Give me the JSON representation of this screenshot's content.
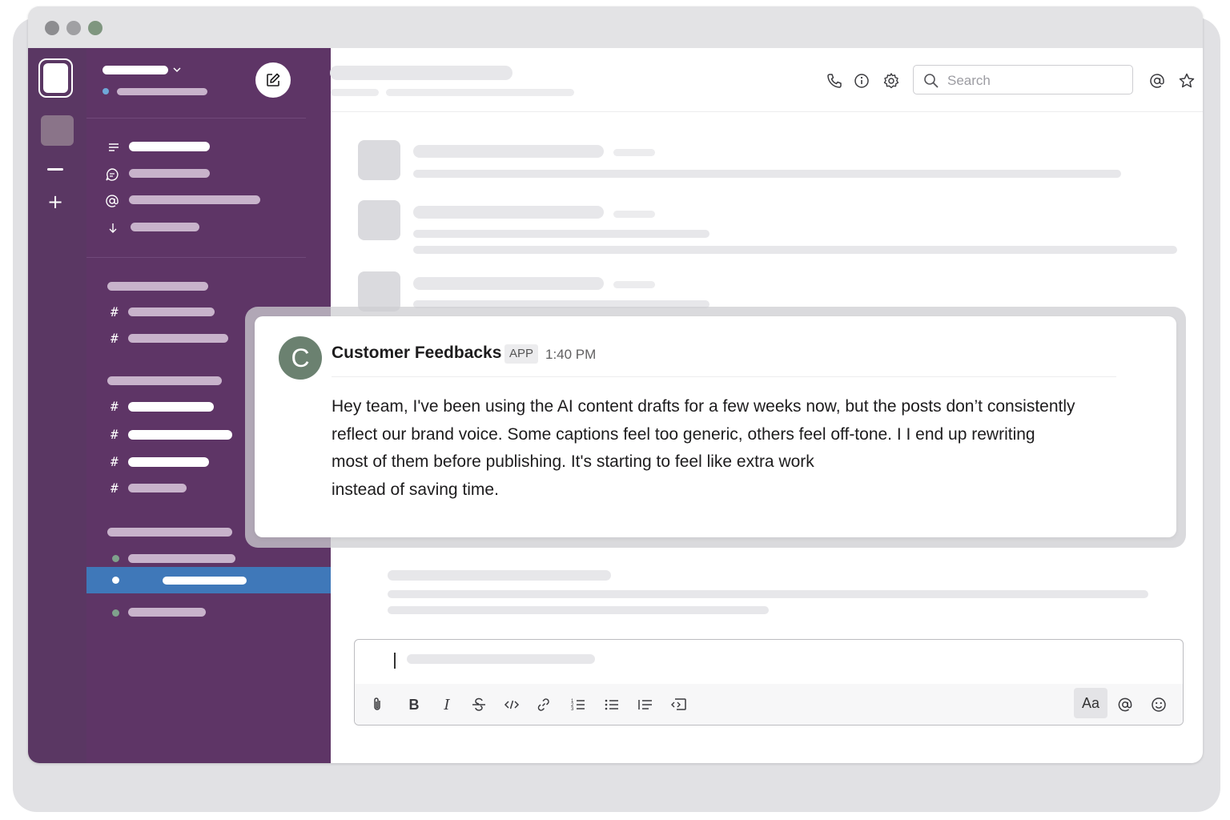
{
  "toolbar": {
    "search_placeholder": "Search"
  },
  "composer": {
    "font_button_label": "Aa"
  },
  "message": {
    "avatar_initial": "C",
    "sender": "Customer Feedbacks",
    "badge": "APP",
    "time": "1:40 PM",
    "lines": [
      "Hey team, I've been using the AI content drafts for a few weeks now, but the posts don’t consistently",
      "reflect our brand voice. Some captions feel too generic, others feel off-tone. I I end up rewriting",
      "most of them before publishing. It's starting to feel like extra work",
      "instead of saving time."
    ]
  },
  "icons": {
    "window_controls": [
      "close-dot",
      "minimize-dot",
      "maximize-dot"
    ],
    "header": [
      "phone-icon",
      "info-icon",
      "gear-icon",
      "search-icon",
      "mention-icon",
      "star-icon"
    ],
    "formatting": [
      "attachment-icon",
      "bold-icon",
      "italic-icon",
      "strikethrough-icon",
      "code-icon",
      "link-icon",
      "ordered-list-icon",
      "bullet-list-icon",
      "blockquote-icon",
      "code-block-icon"
    ],
    "composer_right": [
      "mention-icon",
      "emoji-icon"
    ]
  },
  "colors": {
    "workspace_rail": "#5a3763",
    "sidebar": "#5e3566",
    "selected_channel": "#3f78b9",
    "message_avatar": "#6b8170"
  }
}
